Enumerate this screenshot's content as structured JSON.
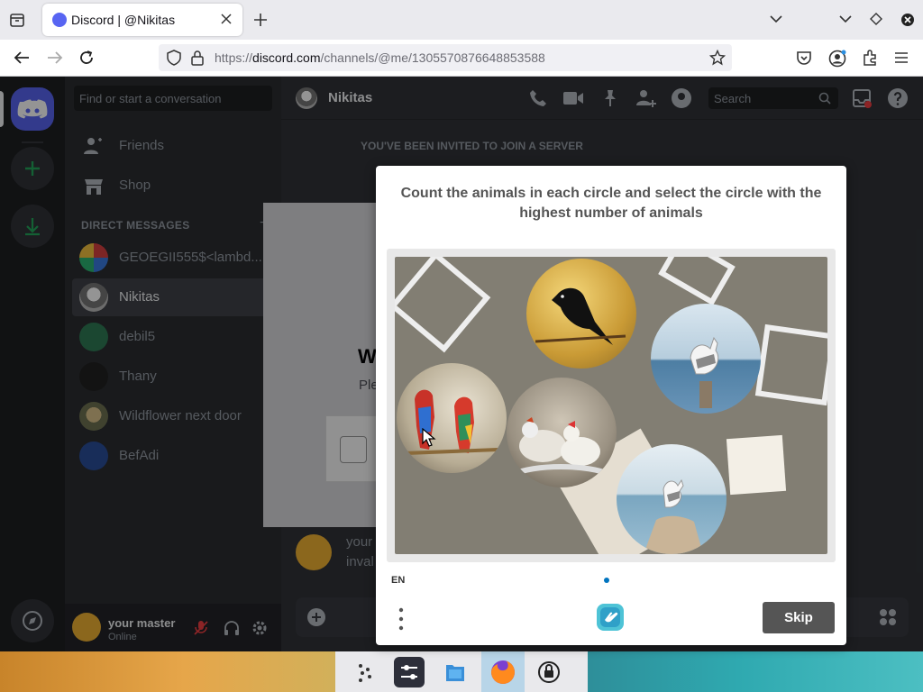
{
  "browser": {
    "tab_title": "Discord | @Nikitas",
    "url_prefix": "https://",
    "url_domain": "discord.com",
    "url_path": "/channels/@me/1305570876648853588"
  },
  "discord": {
    "search_placeholder": "Find or start a conversation",
    "nav": [
      {
        "label": "Friends",
        "icon": "friends-icon"
      },
      {
        "label": "Shop",
        "icon": "shop-icon"
      }
    ],
    "dm_header": "DIRECT MESSAGES",
    "dms": [
      {
        "name": "GEOEGII555$<lambd...",
        "color": "#c23b3b"
      },
      {
        "name": "Nikitas",
        "color": "#d0d0d0"
      },
      {
        "name": "debil5",
        "color": "#2f7a55"
      },
      {
        "name": "Thany",
        "color": "#333333"
      },
      {
        "name": "Wildflower next door",
        "color": "#8a8f6a"
      },
      {
        "name": "BefAdi",
        "color": "#2a4e9a"
      }
    ],
    "user": {
      "name": "your master",
      "status": "Online"
    },
    "channel_name": "Nikitas",
    "header_search": "Search",
    "invite_label": "YOU'VE BEEN INVITED TO JOIN A SERVER",
    "modal_heading_partial": "W",
    "modal_sub_partial": "Ple",
    "message_partial_1": "your",
    "message_partial_2": "inval"
  },
  "captcha": {
    "prompt": "Count the animals in each circle and select the circle with the highest number of animals",
    "language": "EN",
    "skip_label": "Skip",
    "circles": [
      {
        "subject": "crow",
        "count": 1
      },
      {
        "subject": "seagull",
        "count": 1
      },
      {
        "subject": "parrots",
        "count": 2
      },
      {
        "subject": "chickens",
        "count": 2
      },
      {
        "subject": "seagull on rock",
        "count": 1
      }
    ]
  },
  "taskbar": {
    "apps": [
      "apps-grid-icon",
      "settings-sliders-icon",
      "files-icon",
      "firefox-icon",
      "lock-icon"
    ]
  },
  "colors": {
    "discord_blurple": "#5865f2",
    "captcha_skip": "#555555",
    "captcha_logo": "#4ec3d6"
  }
}
